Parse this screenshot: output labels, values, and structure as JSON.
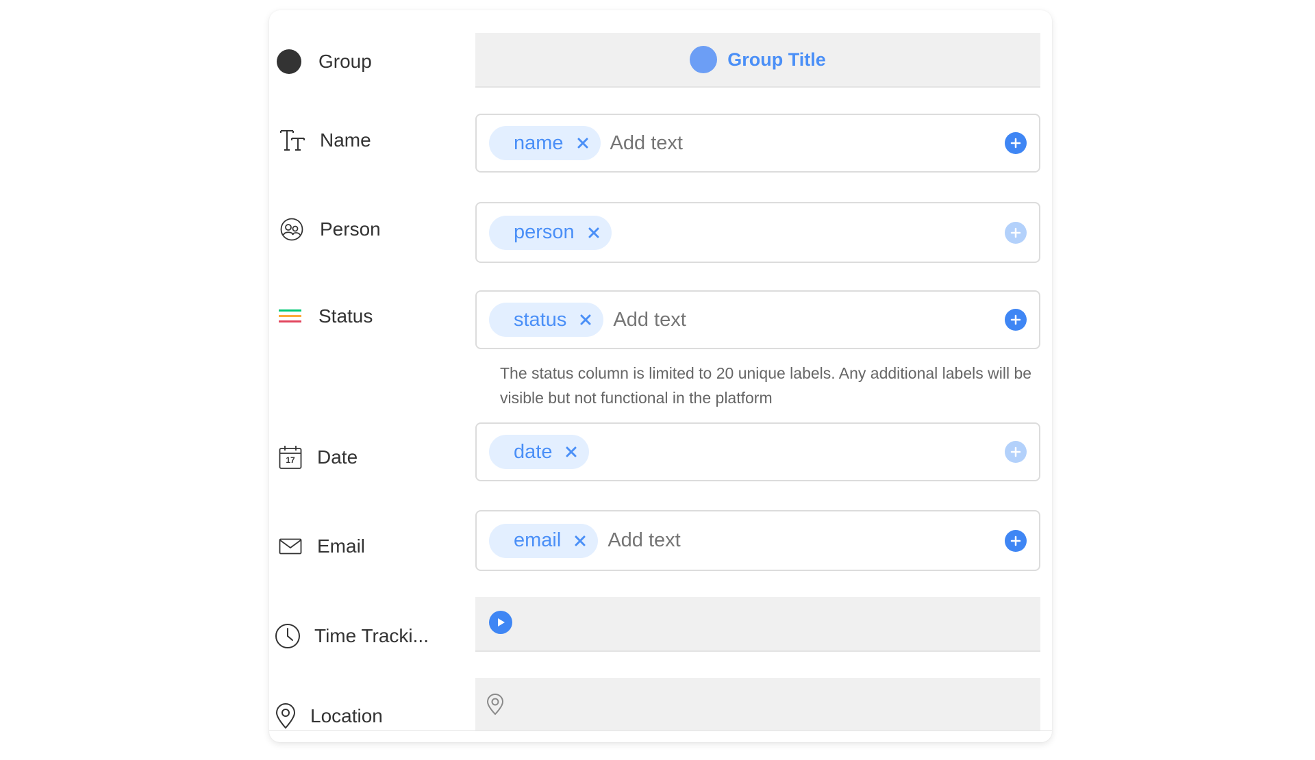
{
  "colors": {
    "accent": "#4a8ff7",
    "group_dot_label": "#333333",
    "group_dot_field": "#6c9ef5",
    "tag_bg": "#e3efff",
    "plus_active": "#3f86f4",
    "plus_faded": "#b3d1fb",
    "status_lines": [
      "#e2445c",
      "#fdab3d",
      "#00c875"
    ]
  },
  "rows": {
    "group": {
      "label": "Group",
      "icon": "filled-circle-icon",
      "title": "Group Title"
    },
    "name": {
      "label": "Name",
      "icon": "text-type-icon",
      "tag": "name",
      "placeholder": "Add text",
      "plus_enabled": true
    },
    "person": {
      "label": "Person",
      "icon": "people-icon",
      "tag": "person",
      "plus_enabled": false
    },
    "status": {
      "label": "Status",
      "icon": "status-lines-icon",
      "tag": "status",
      "placeholder": "Add text",
      "plus_enabled": true,
      "note": "The status column is limited to 20 unique labels. Any additional labels will be visible but not functional in the platform"
    },
    "date": {
      "label": "Date",
      "icon": "calendar-icon",
      "calendar_day": "17",
      "tag": "date",
      "plus_enabled": false
    },
    "email": {
      "label": "Email",
      "icon": "envelope-icon",
      "tag": "email",
      "placeholder": "Add text",
      "plus_enabled": true
    },
    "time_tracking": {
      "label": "Time Tracki...",
      "icon": "clock-icon",
      "control_icon": "play-icon"
    },
    "location": {
      "label": "Location",
      "icon": "map-pin-icon",
      "field_icon": "map-pin-icon"
    }
  }
}
